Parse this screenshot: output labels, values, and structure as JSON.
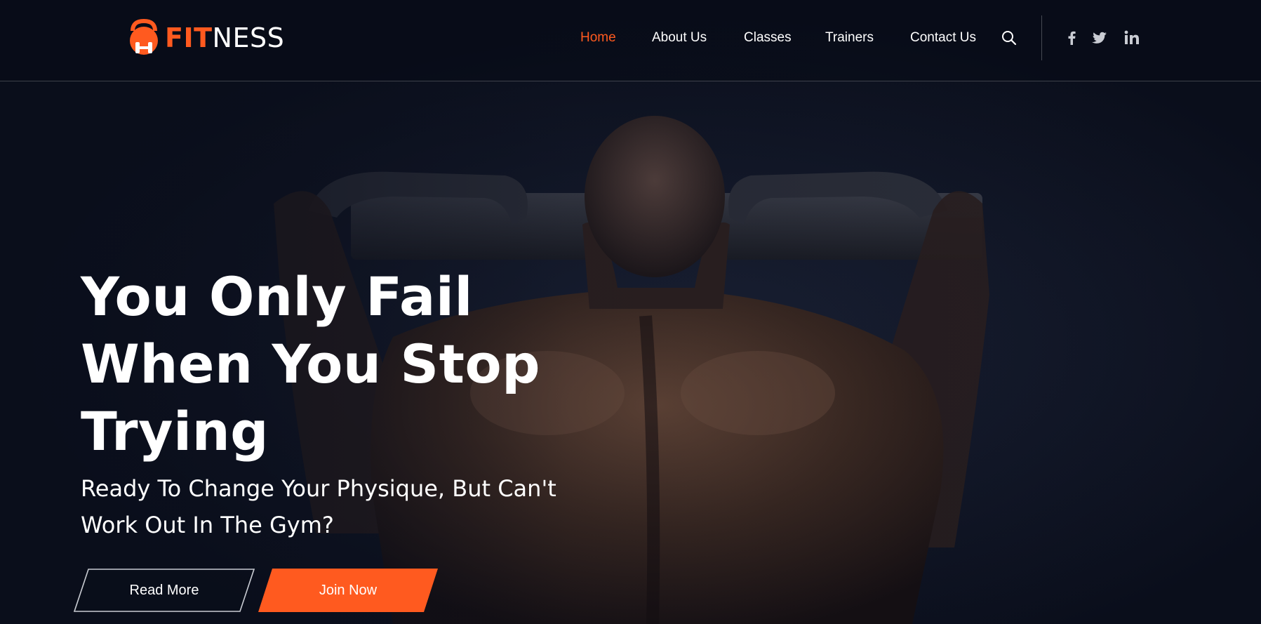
{
  "brand": {
    "name_accent": "FIT",
    "name_rest": "NESS",
    "accent_color": "#ff5a1f"
  },
  "nav": {
    "items": [
      {
        "label": "Home",
        "active": true
      },
      {
        "label": "About Us",
        "active": false
      },
      {
        "label": "Classes",
        "active": false
      },
      {
        "label": "Trainers",
        "active": false
      },
      {
        "label": "Contact Us",
        "active": false
      }
    ],
    "search_icon": "search-icon",
    "social_icons": [
      "facebook-icon",
      "twitter-icon",
      "linkedin-icon"
    ]
  },
  "hero": {
    "headline_lines": [
      "You Only Fail",
      "When You Stop",
      "Trying"
    ],
    "subtitle_lines": [
      "Ready To Change Your Physique, But Can't",
      "Work Out In The Gym?"
    ],
    "read_more_label": "Read More",
    "join_now_label": "Join Now"
  },
  "colors": {
    "background": "#0a0e1b",
    "accent": "#ff5a1f",
    "text": "#ffffff"
  }
}
